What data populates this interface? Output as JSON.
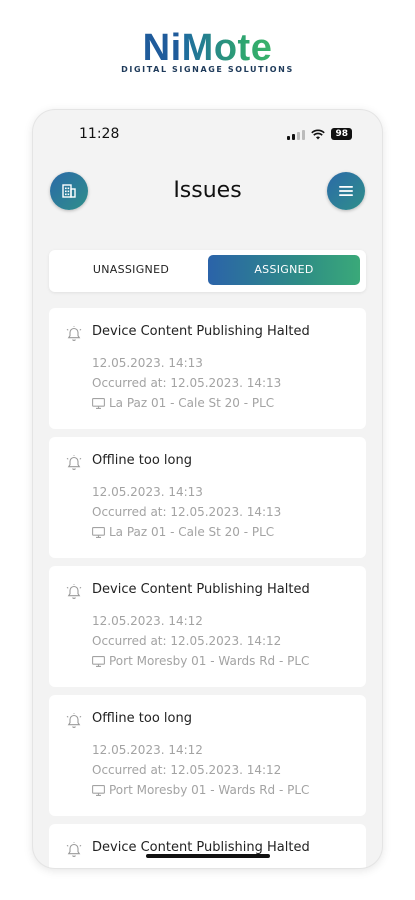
{
  "brand": {
    "name_part1": "Ni",
    "name_part2": "Mote",
    "tagline": "DIGITAL SIGNAGE SOLUTIONS"
  },
  "status_bar": {
    "time": "11:28",
    "battery": "98"
  },
  "header": {
    "title": "Issues",
    "left_icon": "building-icon",
    "right_icon": "menu-icon"
  },
  "tabs": [
    {
      "label": "UNASSIGNED",
      "active": false
    },
    {
      "label": "ASSIGNED",
      "active": true
    }
  ],
  "issues": [
    {
      "title": "Device Content Publishing Halted",
      "date": "12.05.2023. 14:13",
      "occurred": "Occurred at: 12.05.2023. 14:13",
      "device": "La Paz 01 - Cale St 20 - PLC"
    },
    {
      "title": "Offline too long",
      "date": "12.05.2023. 14:13",
      "occurred": "Occurred at: 12.05.2023. 14:13",
      "device": "La Paz 01 - Cale St 20 - PLC"
    },
    {
      "title": "Device Content Publishing Halted",
      "date": "12.05.2023. 14:12",
      "occurred": "Occurred at: 12.05.2023. 14:12",
      "device": "Port Moresby 01 - Wards Rd - PLC"
    },
    {
      "title": "Offline too long",
      "date": "12.05.2023. 14:12",
      "occurred": "Occurred at: 12.05.2023. 14:12",
      "device": "Port Moresby 01 - Wards Rd - PLC"
    },
    {
      "title": "Device Content Publishing Halted"
    }
  ],
  "colors": {
    "primary_blue": "#2b63a9",
    "accent_green": "#3aa979",
    "muted_text": "#a3a3a3"
  }
}
